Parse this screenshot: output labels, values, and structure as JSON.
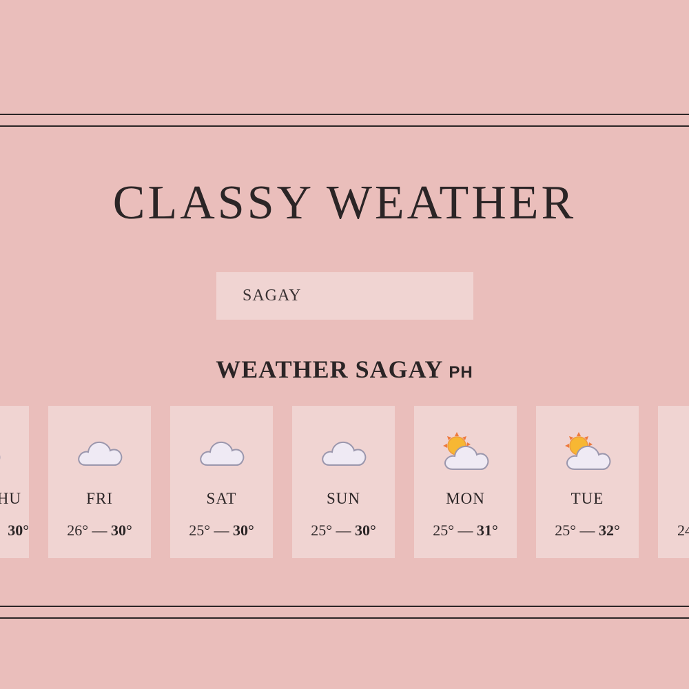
{
  "app": {
    "title": "Classy Weather"
  },
  "search": {
    "value": "SAGAY"
  },
  "location": {
    "prefix": "Weather",
    "city": "Sagay",
    "country": "PH"
  },
  "colors": {
    "background": "#eabebb",
    "card": "#f0d4d2",
    "text": "#2b2526",
    "cloud": "#efeaf4",
    "sun": "#f7b733"
  },
  "forecast": [
    {
      "day": "THU",
      "min": "",
      "max": "30°",
      "icon": "cloud-icon"
    },
    {
      "day": "FRI",
      "min": "26°",
      "max": "30°",
      "icon": "cloud-icon"
    },
    {
      "day": "SAT",
      "min": "25°",
      "max": "30°",
      "icon": "cloud-icon"
    },
    {
      "day": "SUN",
      "min": "25°",
      "max": "30°",
      "icon": "cloud-icon"
    },
    {
      "day": "MON",
      "min": "25°",
      "max": "31°",
      "icon": "sun-behind-cloud-icon"
    },
    {
      "day": "TUE",
      "min": "25°",
      "max": "32°",
      "icon": "sun-behind-cloud-icon"
    },
    {
      "day": "",
      "min": "24",
      "max": "",
      "icon": ""
    }
  ]
}
